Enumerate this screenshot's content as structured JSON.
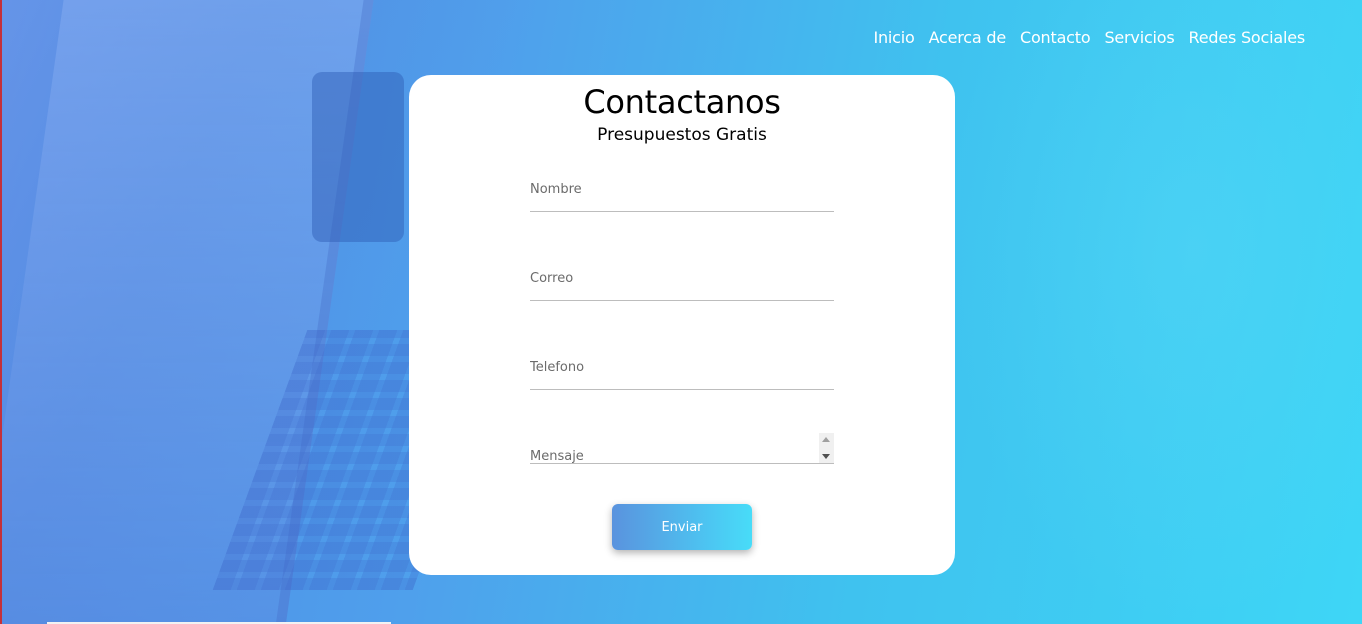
{
  "nav": {
    "items": [
      {
        "label": "Inicio"
      },
      {
        "label": "Acerca de"
      },
      {
        "label": "Contacto"
      },
      {
        "label": "Servicios"
      },
      {
        "label": "Redes Sociales"
      }
    ]
  },
  "contact": {
    "title": "Contactanos",
    "subtitle": "Presupuestos Gratis",
    "fields": {
      "nombre": {
        "placeholder": "Nombre",
        "value": ""
      },
      "correo": {
        "placeholder": "Correo",
        "value": ""
      },
      "telefono": {
        "placeholder": "Telefono",
        "value": ""
      },
      "mensaje": {
        "placeholder": "Mensaje",
        "value": ""
      }
    },
    "submit_label": "Enviar"
  },
  "colors": {
    "background_gradient_start": "#4f86e4",
    "background_gradient_end": "#3ed6f6",
    "card_background": "#ffffff",
    "nav_text": "#ffffff",
    "button_gradient_start": "#5a93de",
    "button_gradient_end": "#48dcf8"
  }
}
